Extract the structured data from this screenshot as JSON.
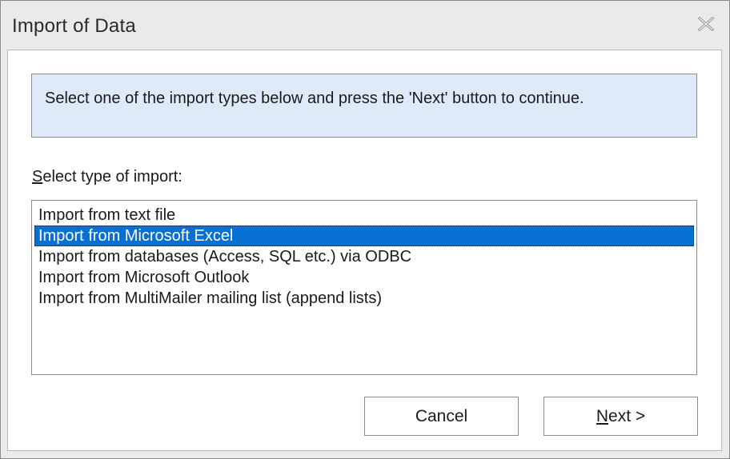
{
  "window": {
    "title": "Import of Data",
    "close_icon": "close-icon"
  },
  "info": {
    "text": "Select one of the import types below and press the 'Next' button to continue."
  },
  "import_list": {
    "label_mnemonic": "S",
    "label_rest": "elect type of import:",
    "selected_index": 1,
    "items": [
      "Import from text file",
      "Import from Microsoft Excel",
      "Import from databases (Access, SQL etc.) via ODBC",
      "Import from Microsoft Outlook",
      "Import from MultiMailer mailing list (append lists)"
    ]
  },
  "buttons": {
    "cancel": "Cancel",
    "next_mnemonic": "N",
    "next_rest": "ext >"
  },
  "colors": {
    "selection": "#0a6fd2",
    "info_background": "#deeaf8"
  }
}
